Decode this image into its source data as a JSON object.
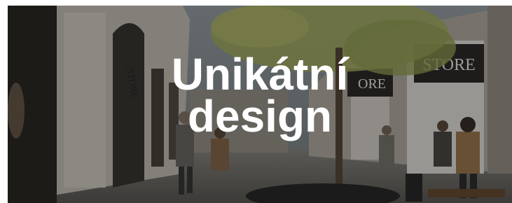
{
  "banner": {
    "title_line1": "Unikátní",
    "title_line2": "design",
    "store_sign": "STORE",
    "store_sign_partial": "ORE",
    "side_sign": "STORE"
  },
  "colors": {
    "text": "#ffffff",
    "overlay": "rgba(0,0,0,0.35)"
  }
}
